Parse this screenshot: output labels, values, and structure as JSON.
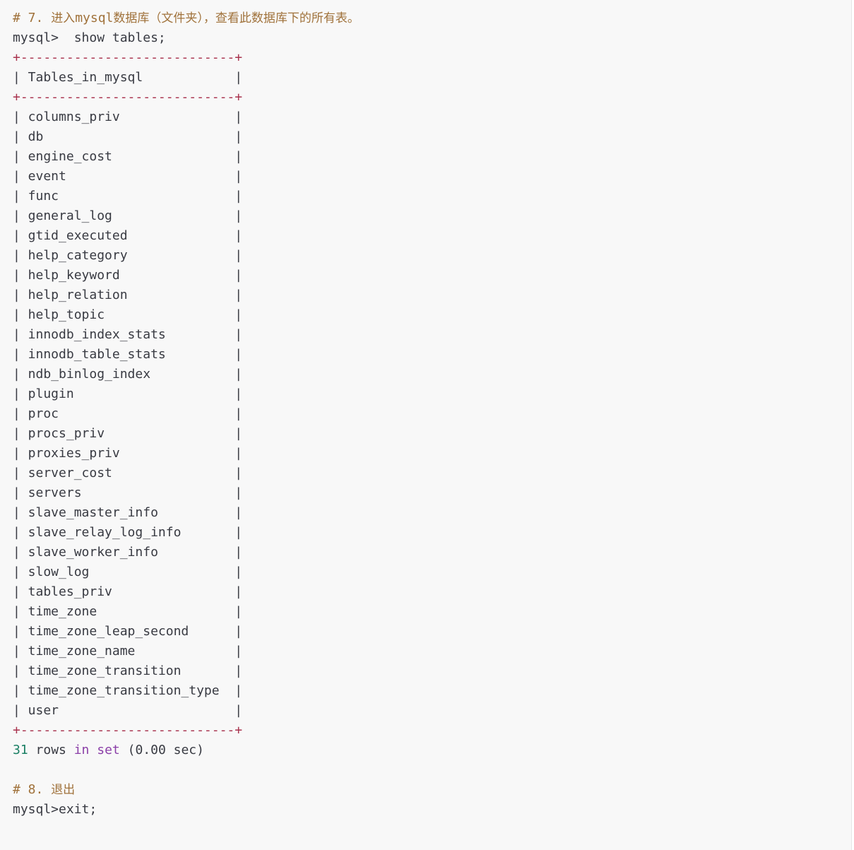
{
  "step7": {
    "comment_prefix": "# 7. ",
    "comment_cn1": "进入",
    "comment_db": "mysql",
    "comment_cn2": "数据库（文件夹），查看此数据库下的所有表。"
  },
  "prompt1": "mysql>  show tables;",
  "table": {
    "border": "+----------------------------+",
    "header": "| Tables_in_mysql            |",
    "rows": [
      "| columns_priv               |",
      "| db                         |",
      "| engine_cost                |",
      "| event                      |",
      "| func                       |",
      "| general_log                |",
      "| gtid_executed              |",
      "| help_category              |",
      "| help_keyword               |",
      "| help_relation              |",
      "| help_topic                 |",
      "| innodb_index_stats         |",
      "| innodb_table_stats         |",
      "| ndb_binlog_index           |",
      "| plugin                     |",
      "| proc                       |",
      "| procs_priv                 |",
      "| proxies_priv               |",
      "| server_cost                |",
      "| servers                    |",
      "| slave_master_info          |",
      "| slave_relay_log_info       |",
      "| slave_worker_info          |",
      "| slow_log                   |",
      "| tables_priv                |",
      "| time_zone                  |",
      "| time_zone_leap_second      |",
      "| time_zone_name             |",
      "| time_zone_transition       |",
      "| time_zone_transition_type  |",
      "| user                       |"
    ]
  },
  "result": {
    "count": "31",
    "rows_word": " rows ",
    "in_word": "in",
    "space": " ",
    "set_word": "set",
    "timing": " (0.00 sec)"
  },
  "step8": {
    "comment_prefix": "# 8. ",
    "comment_cn": "退出"
  },
  "prompt2": "mysql>exit;",
  "colors": {
    "background": "#f8f8f8",
    "comment": "#a0723b",
    "border": "#a8324d",
    "keyword": "#8b3fa8",
    "number": "#1a7f64",
    "text": "#383a42"
  }
}
